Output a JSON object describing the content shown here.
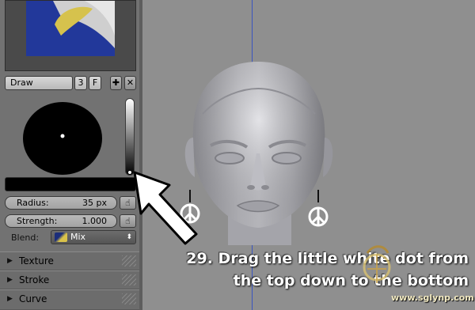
{
  "brush": {
    "name": "Draw",
    "users": "3",
    "fake_user": "F",
    "add_icon": "plus-icon",
    "remove_icon": "x-icon"
  },
  "color": {
    "current_hex": "#000000"
  },
  "radius": {
    "label": "Radius:",
    "value": "35 px",
    "pressure_icon": "hand-pressure-icon"
  },
  "strength": {
    "label": "Strength:",
    "value": "1.000",
    "pressure_icon": "hand-pressure-icon"
  },
  "blend": {
    "label": "Blend:",
    "value": "Mix"
  },
  "sections": [
    {
      "title": "Texture"
    },
    {
      "title": "Stroke"
    },
    {
      "title": "Curve"
    }
  ],
  "caption": {
    "line1": "29. Drag the little white dot from",
    "line2": "the top down to the bottom"
  },
  "watermark": {
    "url": "www.sglynp.com"
  },
  "colors": {
    "panel_bg": "#727272",
    "viewport_bg": "#8f8f8f",
    "grid_axis": "#3a55c0",
    "caption_text": "#ffffff"
  }
}
